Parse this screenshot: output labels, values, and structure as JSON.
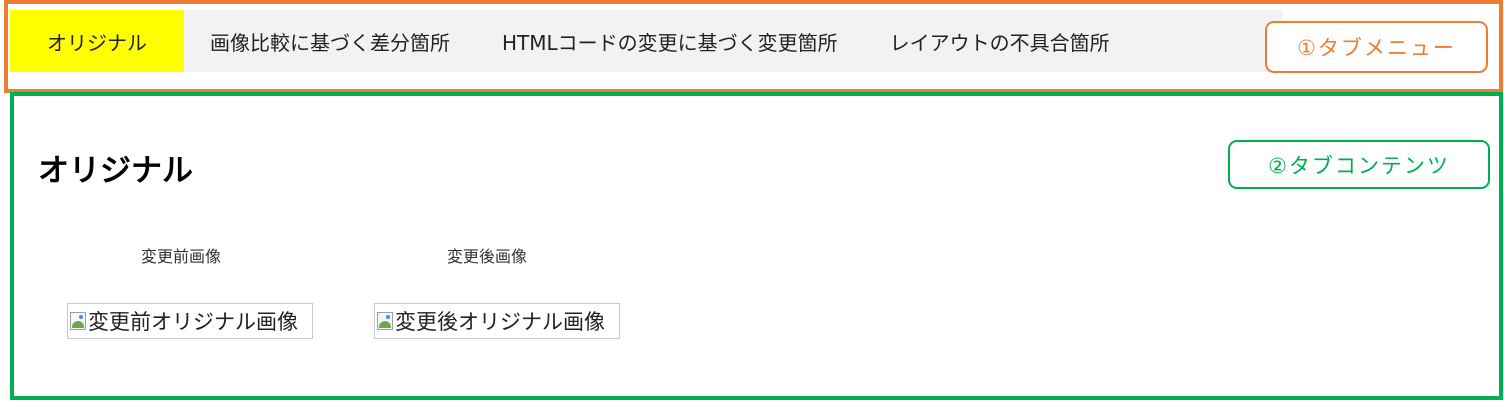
{
  "tabs": [
    {
      "label": "オリジナル",
      "active": true
    },
    {
      "label": "画像比較に基づく差分箇所",
      "active": false
    },
    {
      "label": "HTMLコードの変更に基づく変更箇所",
      "active": false
    },
    {
      "label": "レイアウトの不具合箇所",
      "active": false
    }
  ],
  "annotations": {
    "tab_menu": "①タブメニュー",
    "tab_content": "②タブコンテンツ"
  },
  "content": {
    "title": "オリジナル",
    "before": {
      "label": "変更前画像",
      "alt": "変更前オリジナル画像"
    },
    "after": {
      "label": "変更後画像",
      "alt": "変更後オリジナル画像"
    }
  },
  "colors": {
    "tab_menu_frame": "#ED7D31",
    "tab_content_frame": "#00B050",
    "active_tab": "#FFFF00",
    "tab_bar_bg": "#F2F2F2"
  }
}
